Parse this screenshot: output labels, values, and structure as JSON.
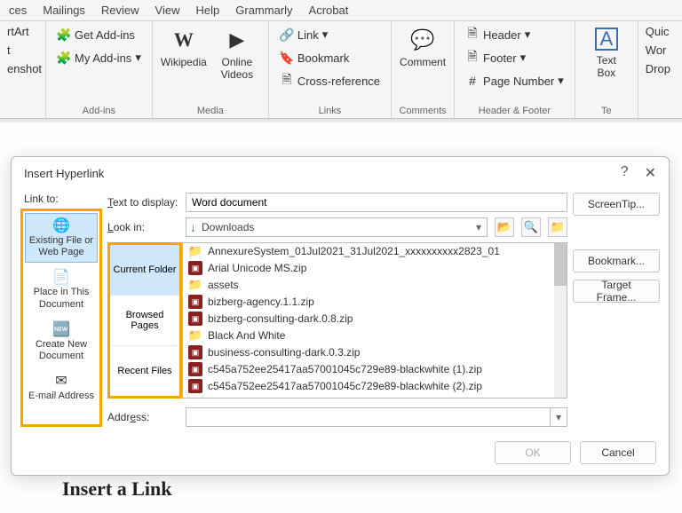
{
  "tabs": [
    "ces",
    "Mailings",
    "Review",
    "View",
    "Help",
    "Grammarly",
    "Acrobat"
  ],
  "ribbon": {
    "partial_left": [
      "rtArt",
      "t",
      "enshot"
    ],
    "addins": {
      "get": "Get Add-ins",
      "my": "My Add-ins",
      "group": "Add-ins"
    },
    "media": {
      "wikipedia": "Wikipedia",
      "videos": "Online Videos",
      "group": "Media"
    },
    "links": {
      "link": "Link",
      "bookmark": "Bookmark",
      "crossref": "Cross-reference",
      "group": "Links"
    },
    "comments": {
      "comment": "Comment",
      "group": "Comments"
    },
    "headerfooter": {
      "header": "Header",
      "footer": "Footer",
      "pagenum": "Page Number",
      "group": "Header & Footer"
    },
    "text": {
      "textbox": "Text Box",
      "group": "Te"
    },
    "partial_right": [
      "Quic",
      "Wor",
      "Drop"
    ]
  },
  "doc": {
    "heading": "Insert a Link"
  },
  "dialog": {
    "title": "Insert Hyperlink",
    "linkto_label": "Link to:",
    "linkto": [
      {
        "label": "Existing File or Web Page",
        "selected": true
      },
      {
        "label": "Place in This Document",
        "selected": false
      },
      {
        "label": "Create New Document",
        "selected": false
      },
      {
        "label": "E-mail Address",
        "selected": false
      }
    ],
    "text_to_display_label": "Text to display:",
    "text_to_display_value": "Word document",
    "lookin_label": "Look in:",
    "lookin_value": "Downloads",
    "browse_tabs": [
      {
        "label": "Current Folder",
        "selected": true
      },
      {
        "label": "Browsed Pages",
        "selected": false
      },
      {
        "label": "Recent Files",
        "selected": false
      }
    ],
    "files": [
      {
        "name": "AnnexureSystem_01Jul2021_31Jul2021_xxxxxxxxxx2823_01",
        "type": "folder"
      },
      {
        "name": "Arial Unicode MS.zip",
        "type": "zip"
      },
      {
        "name": "assets",
        "type": "folder"
      },
      {
        "name": "bizberg-agency.1.1.zip",
        "type": "zip"
      },
      {
        "name": "bizberg-consulting-dark.0.8.zip",
        "type": "zip"
      },
      {
        "name": "Black And White",
        "type": "folder"
      },
      {
        "name": "business-consulting-dark.0.3.zip",
        "type": "zip"
      },
      {
        "name": "c545a752ee25417aa57001045c729e89-blackwhite (1).zip",
        "type": "zip"
      },
      {
        "name": "c545a752ee25417aa57001045c729e89-blackwhite (2).zip",
        "type": "zip"
      }
    ],
    "address_label": "Address:",
    "address_value": "",
    "buttons": {
      "screentip": "ScreenTip...",
      "bookmark": "Bookmark...",
      "targetframe": "Target Frame...",
      "ok": "OK",
      "cancel": "Cancel"
    }
  }
}
